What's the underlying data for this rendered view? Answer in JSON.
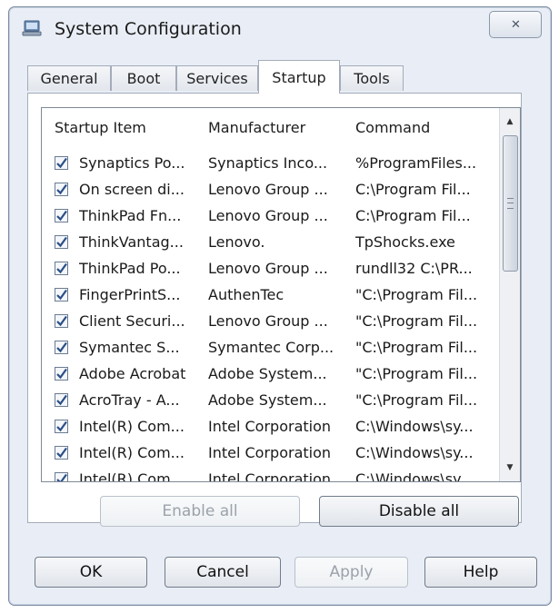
{
  "window": {
    "title": "System Configuration",
    "close_glyph": "✕"
  },
  "tabs": [
    {
      "label": "General",
      "active": false
    },
    {
      "label": "Boot",
      "active": false
    },
    {
      "label": "Services",
      "active": false
    },
    {
      "label": "Startup",
      "active": true
    },
    {
      "label": "Tools",
      "active": false
    }
  ],
  "startup_list": {
    "columns": [
      "Startup Item",
      "Manufacturer",
      "Command"
    ],
    "rows": [
      {
        "item": "Synaptics Po...",
        "manufacturer": "Synaptics Inco...",
        "command": "%ProgramFiles...",
        "checked": true
      },
      {
        "item": "On screen di...",
        "manufacturer": "Lenovo Group ...",
        "command": "C:\\Program Fil...",
        "checked": true
      },
      {
        "item": "ThinkPad Fn...",
        "manufacturer": "Lenovo Group ...",
        "command": "C:\\Program Fil...",
        "checked": true
      },
      {
        "item": "ThinkVantag...",
        "manufacturer": "Lenovo.",
        "command": "TpShocks.exe",
        "checked": true
      },
      {
        "item": "ThinkPad Po...",
        "manufacturer": "Lenovo Group ...",
        "command": "rundll32 C:\\PR...",
        "checked": true
      },
      {
        "item": "FingerPrintS...",
        "manufacturer": "AuthenTec",
        "command": "\"C:\\Program Fil...",
        "checked": true
      },
      {
        "item": "Client Securi...",
        "manufacturer": "Lenovo Group ...",
        "command": "\"C:\\Program Fil...",
        "checked": true
      },
      {
        "item": "Symantec S...",
        "manufacturer": "Symantec Corp...",
        "command": "\"C:\\Program Fil...",
        "checked": true
      },
      {
        "item": "Adobe Acrobat",
        "manufacturer": "Adobe System...",
        "command": "\"C:\\Program Fil...",
        "checked": true
      },
      {
        "item": "AcroTray - A...",
        "manufacturer": "Adobe System...",
        "command": "\"C:\\Program Fil...",
        "checked": true
      },
      {
        "item": "Intel(R) Com...",
        "manufacturer": "Intel Corporation",
        "command": "C:\\Windows\\sy...",
        "checked": true
      },
      {
        "item": "Intel(R) Com...",
        "manufacturer": "Intel Corporation",
        "command": "C:\\Windows\\sy...",
        "checked": true
      },
      {
        "item": "Intel(R) Com...",
        "manufacturer": "Intel Corporation",
        "command": "C:\\Windows\\sy...",
        "checked": true
      }
    ]
  },
  "list_buttons": {
    "enable_all": "Enable all",
    "disable_all": "Disable all"
  },
  "dialog_buttons": {
    "ok": "OK",
    "cancel": "Cancel",
    "apply": "Apply",
    "help": "Help"
  },
  "icons": {
    "app": "system-config-icon",
    "check": "check-icon"
  }
}
